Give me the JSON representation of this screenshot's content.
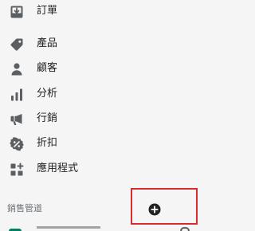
{
  "sidebar": {
    "items": [
      {
        "label": "訂單",
        "icon": "orders-icon"
      },
      {
        "label": "產品",
        "icon": "tag-icon"
      },
      {
        "label": "顧客",
        "icon": "person-icon"
      },
      {
        "label": "分析",
        "icon": "bar-chart-icon"
      },
      {
        "label": "行銷",
        "icon": "megaphone-icon"
      },
      {
        "label": "折扣",
        "icon": "discount-icon"
      },
      {
        "label": "應用程式",
        "icon": "apps-icon"
      }
    ],
    "sales_channels": {
      "heading": "銷售管道",
      "add_icon": "plus-circle-icon",
      "highlight_color": "#d82c2c"
    }
  },
  "colors": {
    "background": "#f5f5f5",
    "text": "#202223",
    "icon": "#5c5f62",
    "muted": "#6d7175",
    "brand_green": "#008060"
  }
}
